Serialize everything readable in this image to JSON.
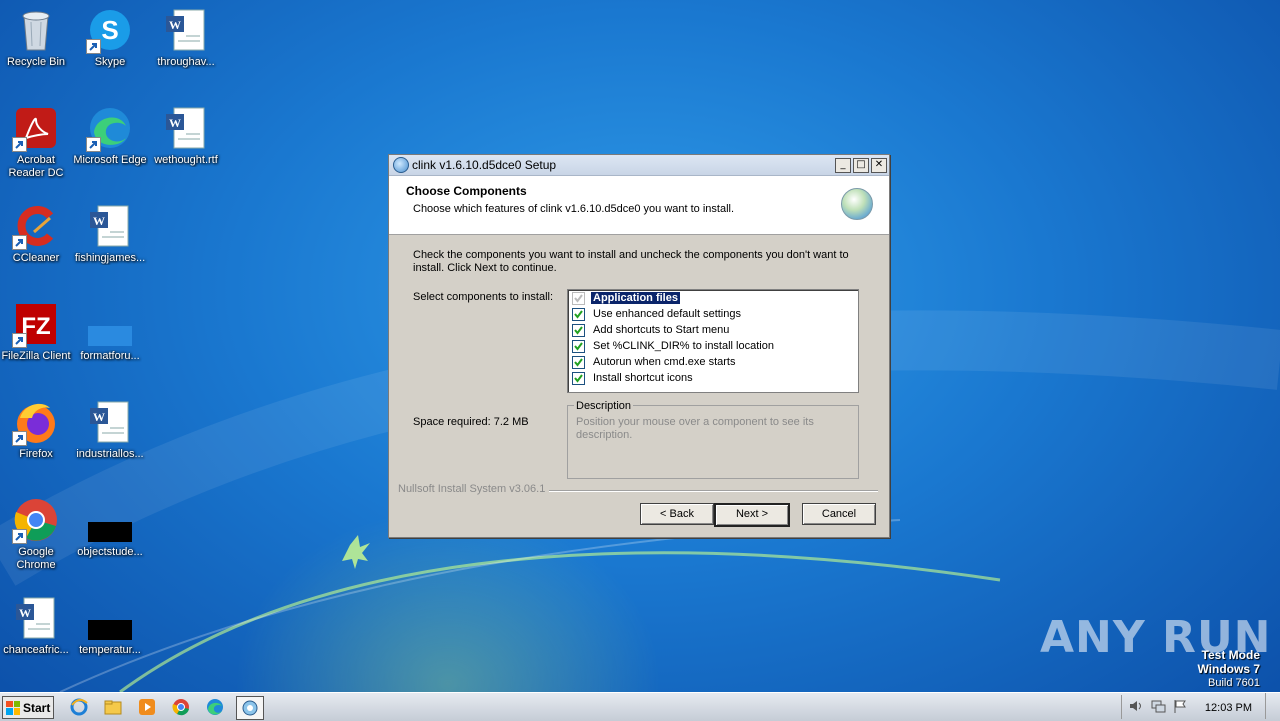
{
  "desktop": {
    "icons": [
      {
        "label": "Recycle Bin",
        "icon": "recycle-bin-icon"
      },
      {
        "label": "Skype",
        "icon": "skype-icon"
      },
      {
        "label": "throughav...",
        "icon": "word-document-icon"
      },
      {
        "label": "Acrobat Reader DC",
        "icon": "acrobat-icon"
      },
      {
        "label": "Microsoft Edge",
        "icon": "edge-icon"
      },
      {
        "label": "wethought.rtf",
        "icon": "word-document-icon"
      },
      {
        "label": "CCleaner",
        "icon": "ccleaner-icon"
      },
      {
        "label": "fishingjames...",
        "icon": "word-document-icon"
      },
      {
        "label": "FileZilla Client",
        "icon": "filezilla-icon"
      },
      {
        "label": "formatforu...",
        "icon": "blank-file-icon"
      },
      {
        "label": "Firefox",
        "icon": "firefox-icon"
      },
      {
        "label": "industriallos...",
        "icon": "word-document-icon"
      },
      {
        "label": "Google Chrome",
        "icon": "chrome-icon"
      },
      {
        "label": "objectstude...",
        "icon": "black-file-icon"
      },
      {
        "label": "chanceafric...",
        "icon": "word-document-icon"
      },
      {
        "label": "temperatur...",
        "icon": "black-file-icon"
      }
    ]
  },
  "dialog": {
    "title": "clink v1.6.10.d5dce0 Setup",
    "title_buttons": [
      "minimize",
      "maximize",
      "close"
    ],
    "header_title": "Choose Components",
    "header_subtitle": "Choose which features of clink v1.6.10.d5dce0 you want to install.",
    "intro": "Check the components you want to install and uncheck the components you don't want to install. Click Next to continue.",
    "select_label": "Select components to install:",
    "components": [
      {
        "label": "Application files",
        "checked": true,
        "disabled": true,
        "selected": true
      },
      {
        "label": "Use enhanced default settings",
        "checked": true
      },
      {
        "label": "Add shortcuts to Start menu",
        "checked": true
      },
      {
        "label": "Set %CLINK_DIR% to install location",
        "checked": true
      },
      {
        "label": "Autorun when cmd.exe starts",
        "checked": true
      },
      {
        "label": "Install shortcut icons",
        "checked": true
      }
    ],
    "space_required": "Space required: 7.2 MB",
    "description_label": "Description",
    "description_text": "Position your mouse over a component to see its description.",
    "branding": "Nullsoft Install System v3.06.1",
    "buttons": {
      "back": "< Back",
      "next": "Next >",
      "cancel": "Cancel"
    }
  },
  "taskbar": {
    "start_label": "Start",
    "items": [
      "internet-explorer-icon",
      "explorer-folder-icon",
      "media-player-icon",
      "chrome-icon",
      "edge-icon",
      "clink-setup-icon"
    ],
    "clock": "12:03 PM"
  },
  "watermark": {
    "line1": "Test Mode",
    "line2": "Windows 7",
    "line3": "Build 7601",
    "anyrun": "ANY RUN"
  },
  "colors": {
    "desktop_blue": "#1a78d0",
    "selection": "#0a246a",
    "dialog_face": "#d4d0c8"
  }
}
